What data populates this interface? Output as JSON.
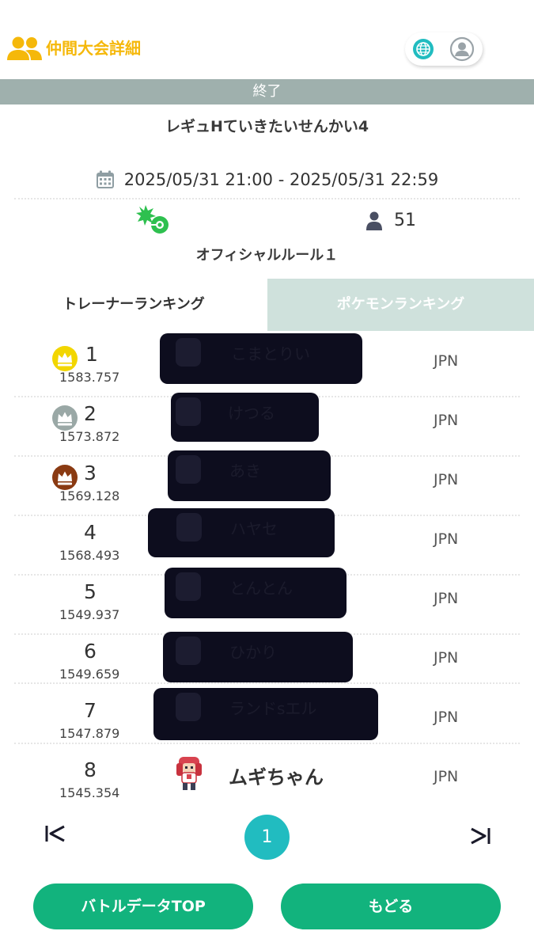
{
  "header": {
    "title": "仲間大会詳細",
    "icons": [
      "group-icon",
      "globe-icon",
      "user-profile-icon"
    ],
    "accent_color": "#f5b80a"
  },
  "tournament": {
    "status": "終了",
    "name": "レギュHていきたいせんかい4",
    "period": "2025/05/31 21:00 - 2025/05/31 22:59",
    "participants": "51",
    "rule": "オフィシャルルール１"
  },
  "tabs": {
    "trainer": "トレーナーランキング",
    "pokemon": "ポケモンランキング",
    "active": "trainer"
  },
  "rankings": [
    {
      "rank": "1",
      "score": "1583.757",
      "name": "こまとりい",
      "country": "JPN",
      "crown": "gold"
    },
    {
      "rank": "2",
      "score": "1573.872",
      "name": "けつる",
      "country": "JPN",
      "crown": "silver"
    },
    {
      "rank": "3",
      "score": "1569.128",
      "name": "あき",
      "country": "JPN",
      "crown": "bronze"
    },
    {
      "rank": "4",
      "score": "1568.493",
      "name": "ハヤセ",
      "country": "JPN",
      "crown": "none"
    },
    {
      "rank": "5",
      "score": "1549.937",
      "name": "とんとん",
      "country": "JPN",
      "crown": "none"
    },
    {
      "rank": "6",
      "score": "1549.659",
      "name": "ひかり",
      "country": "JPN",
      "crown": "none"
    },
    {
      "rank": "7",
      "score": "1547.879",
      "name": "ランドsエル",
      "country": "JPN",
      "crown": "none"
    },
    {
      "rank": "8",
      "score": "1545.354",
      "name": "ムギちゃん",
      "country": "JPN",
      "crown": "none"
    }
  ],
  "pagination": {
    "current": "1",
    "first_icon": "first-page-icon",
    "last_icon": "last-page-icon"
  },
  "buttons": {
    "battle_top": "バトルデータTOP",
    "back": "もどる"
  },
  "colors": {
    "status_bar": "#9fb0ad",
    "tab_inactive": "#cfe1dc",
    "page_current": "#21bcc0",
    "button": "#12b37d",
    "crown_gold": "#f2d600",
    "crown_silver": "#9aa8a6",
    "crown_bronze": "#8a3a12"
  }
}
